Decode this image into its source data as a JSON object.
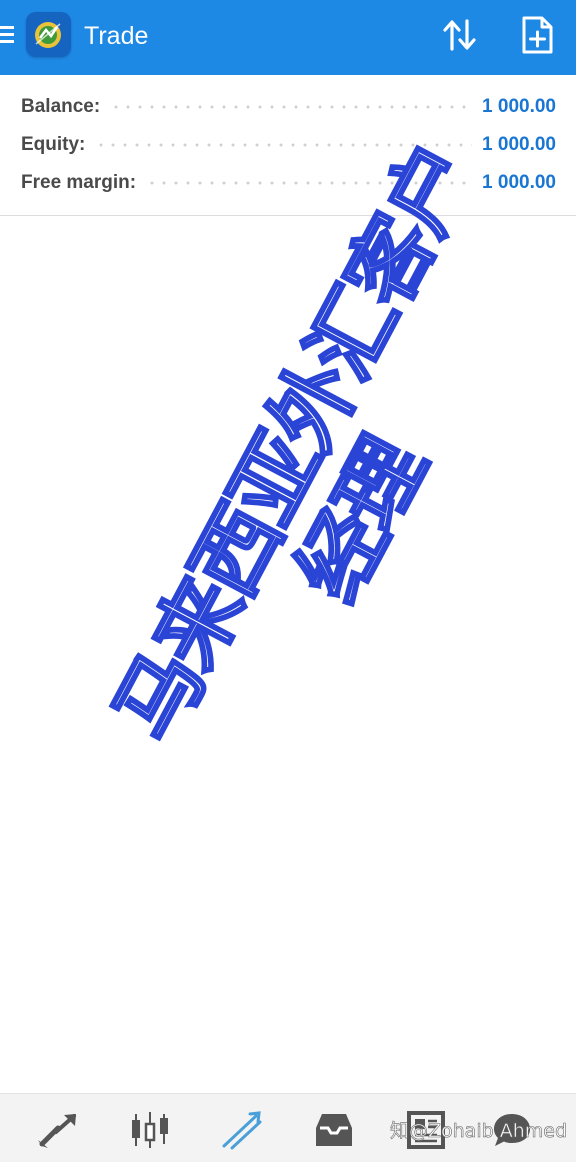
{
  "colors": {
    "header_bg": "#1e88e5",
    "value_color": "#1976d2",
    "watermark_outline": "#2a44d6",
    "active_tab": "#4a9fd8",
    "inactive_tab": "#555555"
  },
  "header": {
    "title": "Trade",
    "menu_icon": "hamburger-icon",
    "logo_icon": "metatrader-logo",
    "actions": [
      {
        "icon": "sort-arrows-icon"
      },
      {
        "icon": "new-order-icon"
      }
    ]
  },
  "account": {
    "rows": [
      {
        "label": "Balance:",
        "value": "1 000.00"
      },
      {
        "label": "Equity:",
        "value": "1 000.00"
      },
      {
        "label": "Free margin:",
        "value": "1 000.00"
      }
    ]
  },
  "watermark": {
    "line1": "马来西亚外汇客户",
    "line2": "经理"
  },
  "bottom_nav": {
    "items": [
      {
        "icon": "quotes-arrows-icon",
        "active": false
      },
      {
        "icon": "candlestick-chart-icon",
        "active": false
      },
      {
        "icon": "trade-icon",
        "active": true
      },
      {
        "icon": "history-inbox-icon",
        "active": false
      },
      {
        "icon": "news-icon",
        "active": false
      },
      {
        "icon": "chat-icon",
        "active": false
      }
    ]
  },
  "credit": "知@Zohaib Ahmed"
}
